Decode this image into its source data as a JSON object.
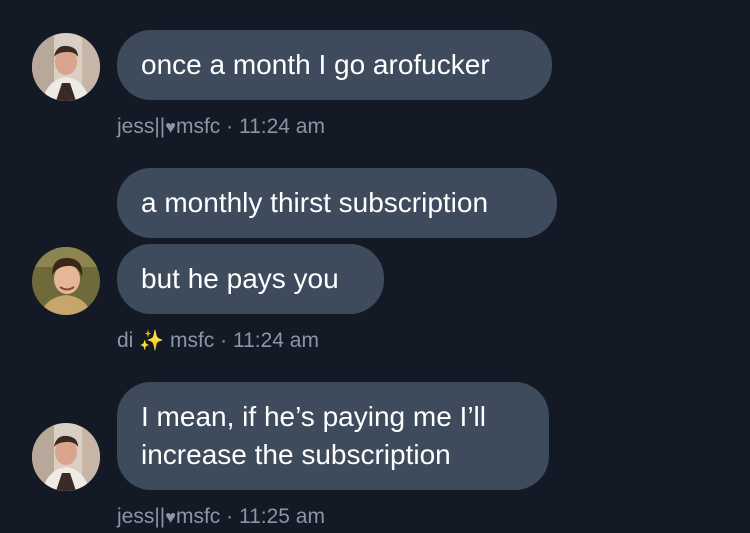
{
  "messages": [
    {
      "group": "jess-1",
      "bubbles": [
        "once a month I go arofucker"
      ],
      "meta": {
        "name": "jess||",
        "heart": "♥",
        "handle": "msfc",
        "separator": "·",
        "time": "11:24 am"
      },
      "avatar": "person-avatar"
    },
    {
      "group": "di",
      "bubbles": [
        "a monthly thirst subscription",
        "but he pays you"
      ],
      "meta": {
        "name": "di",
        "emoji": "✨",
        "handle": "msfc",
        "separator": "·",
        "time": "11:24 am"
      },
      "avatar": "person-avatar"
    },
    {
      "group": "jess-2",
      "bubbles": [
        "I mean, if he’s paying me I’ll increase the subscription"
      ],
      "meta": {
        "name": "jess||",
        "heart": "♥",
        "handle": "msfc",
        "separator": "·",
        "time": "11:25 am"
      },
      "avatar": "person-avatar"
    }
  ],
  "colors": {
    "background": "#141a25",
    "bubble": "#3d4b5c",
    "text": "#ffffff",
    "meta": "#8a96a6"
  }
}
